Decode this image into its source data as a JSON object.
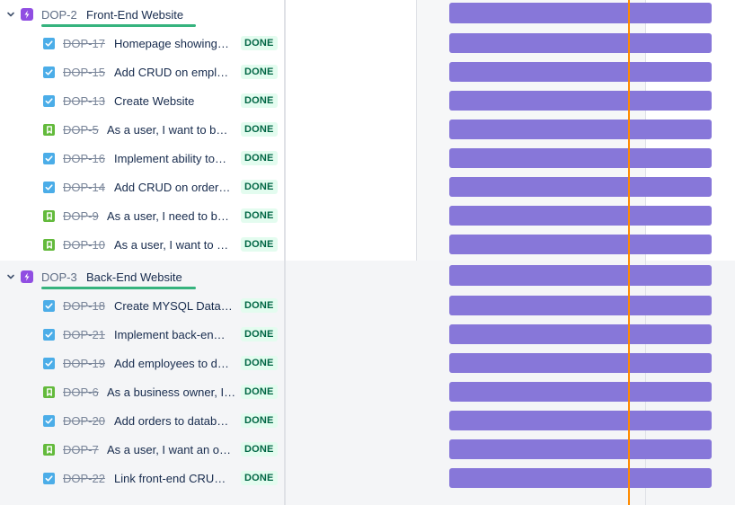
{
  "status_label": "DONE",
  "colors": {
    "epic": "#904ee2",
    "task": "#4bade8",
    "story": "#63ba3c",
    "bar": "#8777d9",
    "today": "#ff8b00",
    "epic_progress": "#36b37e"
  },
  "epics": [
    {
      "key": "DOP-2",
      "title": "Front-End Website",
      "issues": [
        {
          "key": "DOP-17",
          "type": "task",
          "title": "Homepage showing…"
        },
        {
          "key": "DOP-15",
          "type": "task",
          "title": "Add CRUD on empl…"
        },
        {
          "key": "DOP-13",
          "type": "task",
          "title": "Create Website"
        },
        {
          "key": "DOP-5",
          "type": "story",
          "title": "As a user, I want to b…"
        },
        {
          "key": "DOP-16",
          "type": "task",
          "title": "Implement ability to…"
        },
        {
          "key": "DOP-14",
          "type": "task",
          "title": "Add CRUD on order…"
        },
        {
          "key": "DOP-9",
          "type": "story",
          "title": "As a user, I need to b…"
        },
        {
          "key": "DOP-10",
          "type": "story",
          "title": "As a user, I want to …"
        }
      ]
    },
    {
      "key": "DOP-3",
      "title": "Back-End Website",
      "issues": [
        {
          "key": "DOP-18",
          "type": "task",
          "title": "Create MYSQL Data…"
        },
        {
          "key": "DOP-21",
          "type": "task",
          "title": "Implement back-en…"
        },
        {
          "key": "DOP-19",
          "type": "task",
          "title": "Add employees to d…"
        },
        {
          "key": "DOP-6",
          "type": "story",
          "title": "As a business owner, I…"
        },
        {
          "key": "DOP-20",
          "type": "task",
          "title": "Add orders to datab…"
        },
        {
          "key": "DOP-7",
          "type": "story",
          "title": "As a user, I want an o…"
        },
        {
          "key": "DOP-22",
          "type": "task",
          "title": "Link front-end CRU…"
        }
      ]
    }
  ]
}
